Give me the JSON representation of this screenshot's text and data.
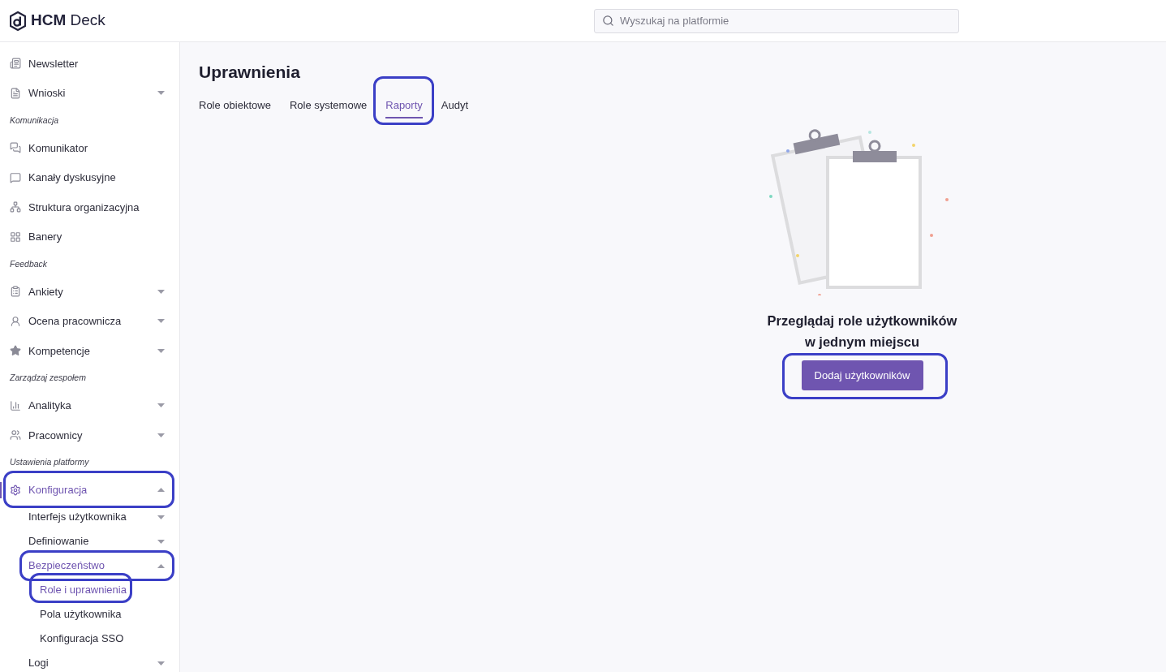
{
  "header": {
    "logo": "**HCM** Deck",
    "search": {
      "placeholder": "Wyszukaj na platformie"
    }
  },
  "sidebar": {
    "items": [
      {
        "kind": "item",
        "label": "Newsletter",
        "selected": false,
        "circled": false
      },
      {
        "kind": "item",
        "label": "Wnioski",
        "expanded": false,
        "selected": false,
        "circled": false
      },
      {
        "kind": "section",
        "label": "Komunikacja"
      },
      {
        "kind": "item",
        "label": "Komunikator",
        "selected": false,
        "circled": false
      },
      {
        "kind": "item",
        "label": "Kanały dyskusyjne",
        "selected": false,
        "circled": false
      },
      {
        "kind": "item",
        "label": "Struktura organizacyjna",
        "selected": false,
        "circled": false
      },
      {
        "kind": "item",
        "label": "Banery",
        "selected": false,
        "circled": false
      },
      {
        "kind": "section",
        "label": "Feedback"
      },
      {
        "kind": "item",
        "label": "Ankiety",
        "expanded": false,
        "selected": false,
        "circled": false
      },
      {
        "kind": "item",
        "label": "Ocena pracownicza",
        "expanded": false,
        "selected": false,
        "circled": false
      },
      {
        "kind": "item",
        "label": "Kompetencje",
        "expanded": false,
        "selected": false,
        "circled": false
      },
      {
        "kind": "section",
        "label": "Zarządzaj zespołem"
      },
      {
        "kind": "item",
        "label": "Analityka",
        "expanded": false,
        "selected": false,
        "circled": false
      },
      {
        "kind": "item",
        "label": "Pracownicy",
        "expanded": false,
        "selected": false,
        "circled": false
      },
      {
        "kind": "section",
        "label": "Ustawienia platformy"
      },
      {
        "kind": "item",
        "label": "Konfiguracja",
        "expanded": true,
        "selected": true,
        "circled": true,
        "children": [
          {
            "label": "Interfejs użytkownika",
            "expanded": false,
            "selected": false,
            "circled": false
          },
          {
            "label": "Definiowanie",
            "expanded": false,
            "selected": false,
            "circled": false
          },
          {
            "label": "Bezpieczeństwo",
            "expanded": true,
            "selected": true,
            "circled": true,
            "children": [
              {
                "label": "Role i uprawnienia",
                "selected": true,
                "circled": true
              },
              {
                "label": "Pola użytkownika",
                "selected": false,
                "circled": false
              },
              {
                "label": "Konfiguracja SSO",
                "selected": false,
                "circled": false
              }
            ]
          },
          {
            "label": "Logi",
            "expanded": false,
            "selected": false,
            "circled": false
          }
        ]
      }
    ]
  },
  "page": {
    "title": "Uprawnienia",
    "tabs": [
      {
        "label": "Role obiektowe",
        "selected": false,
        "circled": false
      },
      {
        "label": "Role systemowe",
        "selected": false,
        "circled": false
      },
      {
        "label": "Raporty",
        "selected": true,
        "circled": true
      },
      {
        "label": "Audyt",
        "selected": false,
        "circled": false
      }
    ],
    "empty_state": {
      "message": "Przeglądaj role użytkowników w jednym miejscu",
      "button": {
        "label": "Dodaj użytkowników",
        "circled": true
      }
    }
  }
}
